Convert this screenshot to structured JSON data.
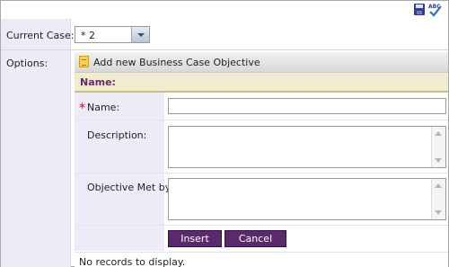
{
  "toolbar": {
    "save_icon": "save-icon",
    "spellcheck_icon": "spellcheck-icon",
    "spellcheck_text": "ABC"
  },
  "sidebar": {
    "current_case_label": "Current Case:",
    "options_label": "Options:"
  },
  "case_select": {
    "value": "* 2"
  },
  "command": {
    "add_label": "Add new Business Case Objective"
  },
  "grid": {
    "header_label": "Name:",
    "empty_text": "No records to display."
  },
  "form": {
    "name_label": "Name:",
    "name_value": "",
    "required_mark": "∗",
    "description_label": "Description:",
    "description_value": "",
    "objective_met_label": "Objective Met by:",
    "objective_met_value": "",
    "insert_label": "Insert",
    "cancel_label": "Cancel"
  },
  "colors": {
    "sidebar_bg": "#efebf6",
    "header_bg": "#f0ecd0",
    "header_text": "#6a2a6a",
    "button_bg": "#5a2a6a"
  }
}
